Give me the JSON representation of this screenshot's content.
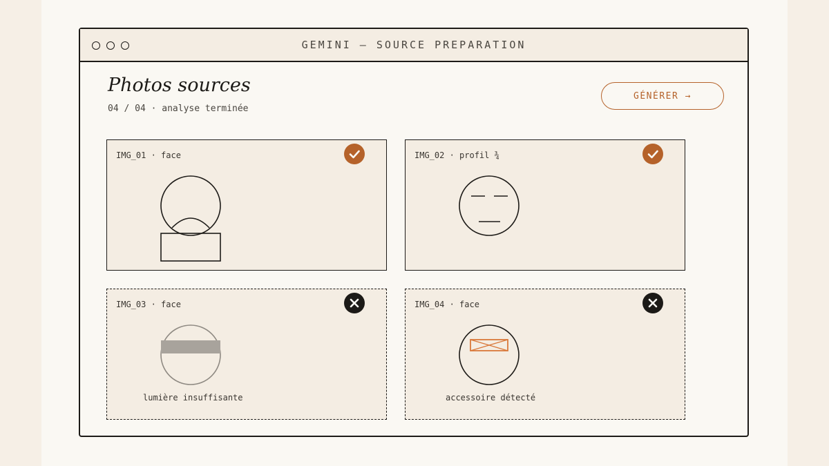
{
  "window": {
    "title": "GEMINI — SOURCE PREPARATION"
  },
  "header": {
    "title": "Photos sources",
    "subtitle": "04 / 04 · analyse terminée",
    "generate_label": "GÉNÉRER →"
  },
  "photos": [
    {
      "label": "IMG_01 · face",
      "status": "accepted",
      "note": ""
    },
    {
      "label": "IMG_02 · profil ¾",
      "status": "accepted",
      "note": ""
    },
    {
      "label": "IMG_03 · face",
      "status": "rejected",
      "note": "lumière insuffisante"
    },
    {
      "label": "IMG_04 · face",
      "status": "rejected",
      "note": "accessoire détecté"
    }
  ],
  "colors": {
    "accent": "#b5622a",
    "ink": "#1c1a17",
    "card_bg": "#f4ede3",
    "page_bg": "#faf8f3",
    "dim_overlay": "#a8a39c"
  },
  "icons": {
    "accepted": "check-icon",
    "rejected": "close-icon"
  }
}
